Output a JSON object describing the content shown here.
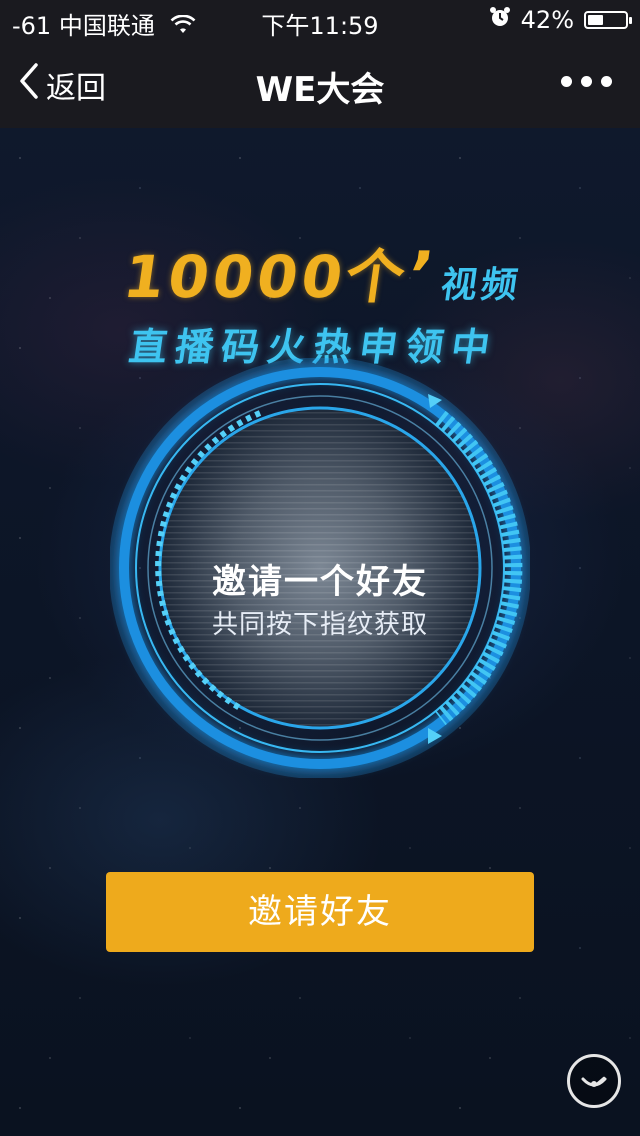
{
  "status_bar": {
    "signal": "-61",
    "carrier": "中国联通",
    "time": "下午11:59",
    "battery_percent": "42%",
    "battery_level": 0.42
  },
  "nav": {
    "back_label": "返回",
    "title": "WE大会"
  },
  "headline": {
    "number": "10000个",
    "quote_mark": "’",
    "suffix": "视频",
    "line2": "直播码火热申领中"
  },
  "circle": {
    "title": "邀请一个好友",
    "subtitle": "共同按下指纹获取"
  },
  "invite_button": {
    "label": "邀请好友"
  },
  "colors": {
    "accent_gold": "#eeaa1c",
    "accent_blue": "#3ec4f0",
    "bar_bg": "#1a1a1f"
  },
  "icons": {
    "back": "chevron-left-icon",
    "more": "more-dots-icon",
    "wifi": "wifi-icon",
    "alarm": "alarm-icon",
    "battery": "battery-icon",
    "float": "floating-window-icon"
  }
}
